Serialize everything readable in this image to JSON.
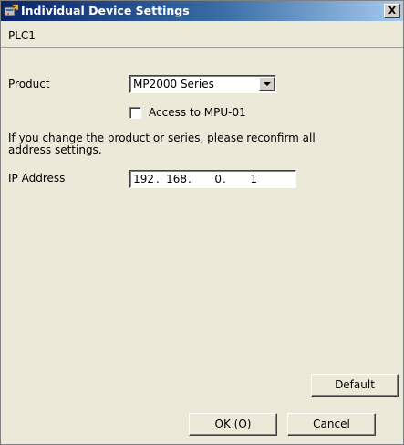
{
  "window": {
    "title": "Individual Device Settings",
    "close_glyph": "X",
    "icon": "device-settings-icon"
  },
  "header": {
    "device_name": "PLC1"
  },
  "product": {
    "label": "Product",
    "selected": "MP2000 Series"
  },
  "access_checkbox": {
    "label": "Access to MPU-01",
    "checked": false
  },
  "note": "If you change the product or series, please reconfirm all address settings.",
  "ip_address": {
    "label": "IP Address",
    "octets": [
      "192",
      "168",
      "0",
      "1"
    ],
    "separator": "."
  },
  "buttons": {
    "default": "Default",
    "ok": "OK (O)",
    "cancel": "Cancel"
  },
  "colors": {
    "title_start": "#0a246a",
    "title_end": "#a6caf0",
    "face": "#ece9d8"
  }
}
